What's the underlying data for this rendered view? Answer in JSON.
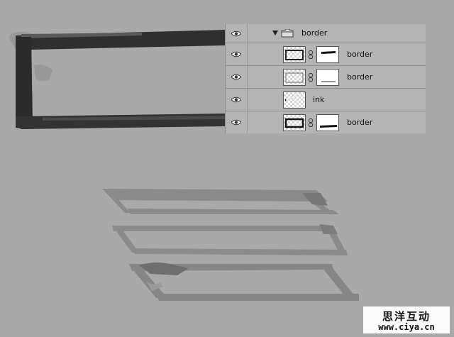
{
  "layers_panel": {
    "group": {
      "name": "border",
      "expanded": true
    },
    "layers": [
      {
        "name": "border",
        "has_mask": true,
        "visible": true
      },
      {
        "name": "border",
        "has_mask": true,
        "visible": true
      },
      {
        "name": "ink",
        "has_mask": false,
        "visible": true
      },
      {
        "name": "border",
        "has_mask": true,
        "visible": true
      }
    ]
  },
  "colors": {
    "canvas_bg": "#a9a9a9",
    "panel_bg": "#b4b4b4",
    "ink_dark": "#2e2e2e",
    "ink_mid": "#7a7a7a"
  },
  "icons": [
    "eye-icon",
    "disclosure-triangle-icon",
    "folder-icon",
    "chain-link-icon"
  ],
  "watermark": {
    "line1": "思洋互动",
    "line2": "www.ciya.cn"
  }
}
